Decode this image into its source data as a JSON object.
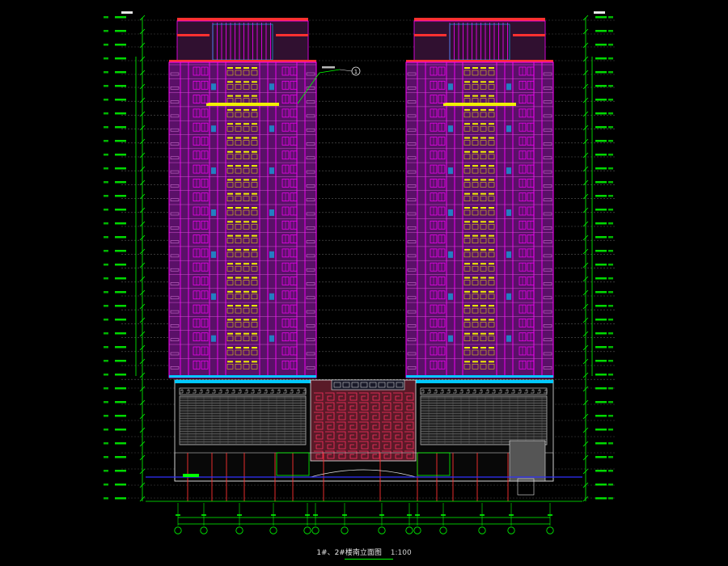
{
  "drawing": {
    "title": "1#、2#楼南立面图",
    "scale": "1:100",
    "callout": "1"
  },
  "colors": {
    "background": "#000000",
    "wall": "#b000b0",
    "frame": "#ff00ff",
    "window": "#f0f000",
    "trim": "#ff3030",
    "glass": "#00c8ff",
    "dim": "#00ff00",
    "line": "#00ffff",
    "podium": "#ff3060",
    "white": "#e6e6e6"
  },
  "icons": [
    "axis-bubble",
    "section-callout"
  ]
}
